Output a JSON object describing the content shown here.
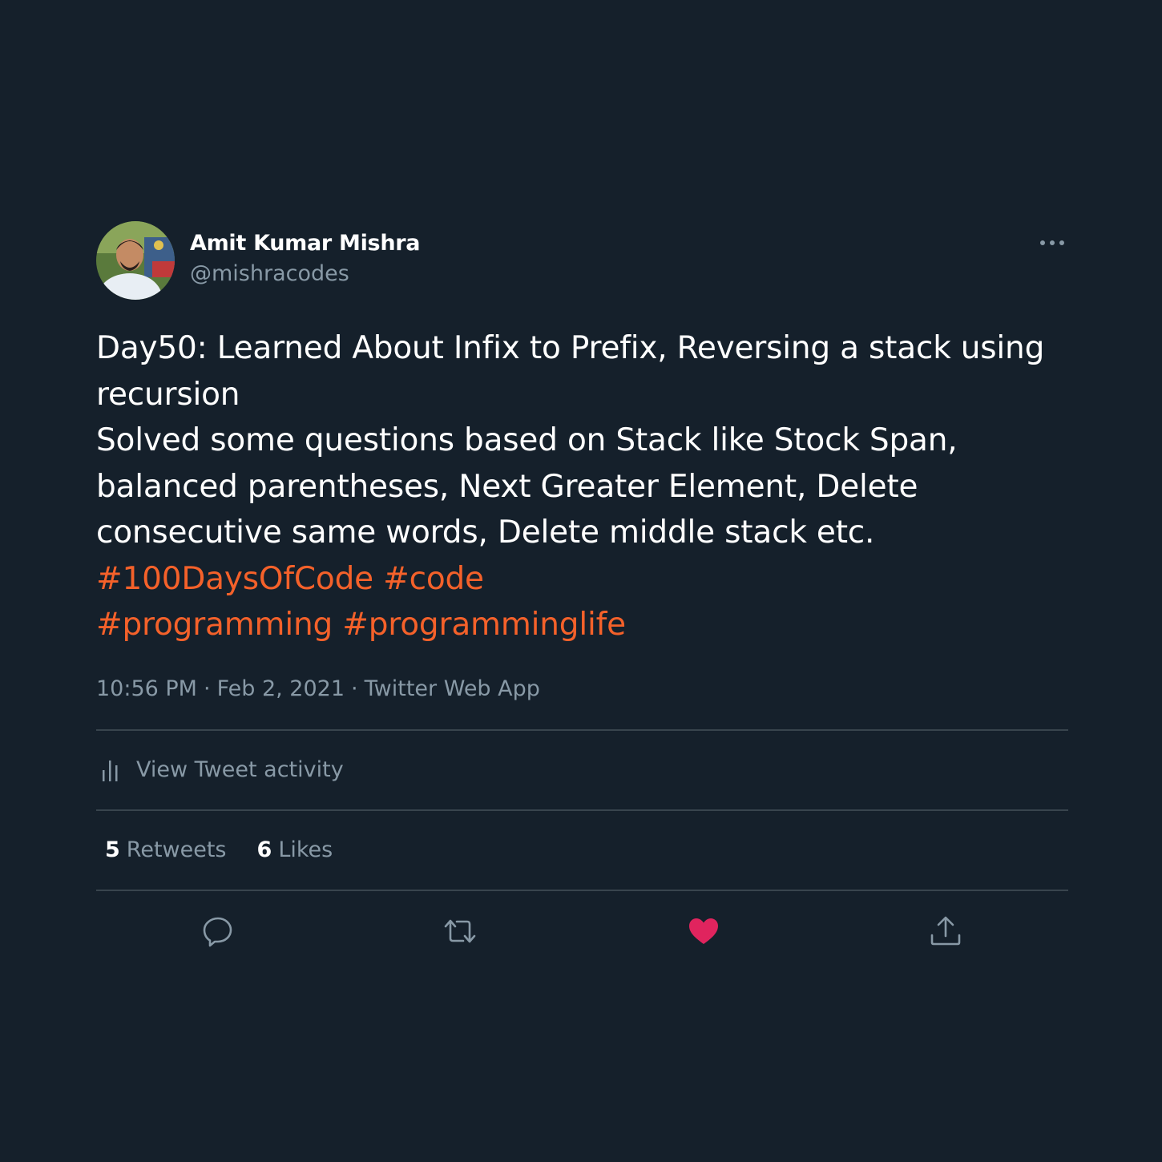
{
  "author": {
    "display_name": "Amit Kumar Mishra",
    "handle": "@mishracodes"
  },
  "tweet": {
    "lines": [
      "Day50: Learned About Infix to Prefix, Reversing a stack using",
      "recursion",
      "Solved some questions based on Stack like Stock Span,",
      "balanced parentheses, Next Greater Element, Delete",
      "consecutive same words, Delete middle stack etc."
    ],
    "hashtags_line1": [
      "#100DaysOfCode",
      "#code"
    ],
    "hashtags_line2": [
      "#programming",
      "#programminglife"
    ]
  },
  "meta": {
    "time": "10:56 PM",
    "date": "Feb 2, 2021",
    "separator": "·",
    "source": "Twitter Web App"
  },
  "activity": {
    "label": "View Tweet activity"
  },
  "stats": {
    "retweets_count": "5",
    "retweets_label": "Retweets",
    "likes_count": "6",
    "likes_label": "Likes"
  },
  "icons": {
    "more": "more-dots-icon",
    "activity": "bar-chart-icon",
    "reply": "reply-icon",
    "retweet": "retweet-icon",
    "like": "heart-icon",
    "share": "share-icon"
  },
  "colors": {
    "background": "#15202b",
    "hashtag": "#f4612a",
    "secondary_text": "#8899a6",
    "divider": "#38444d",
    "liked": "#e0245e"
  }
}
